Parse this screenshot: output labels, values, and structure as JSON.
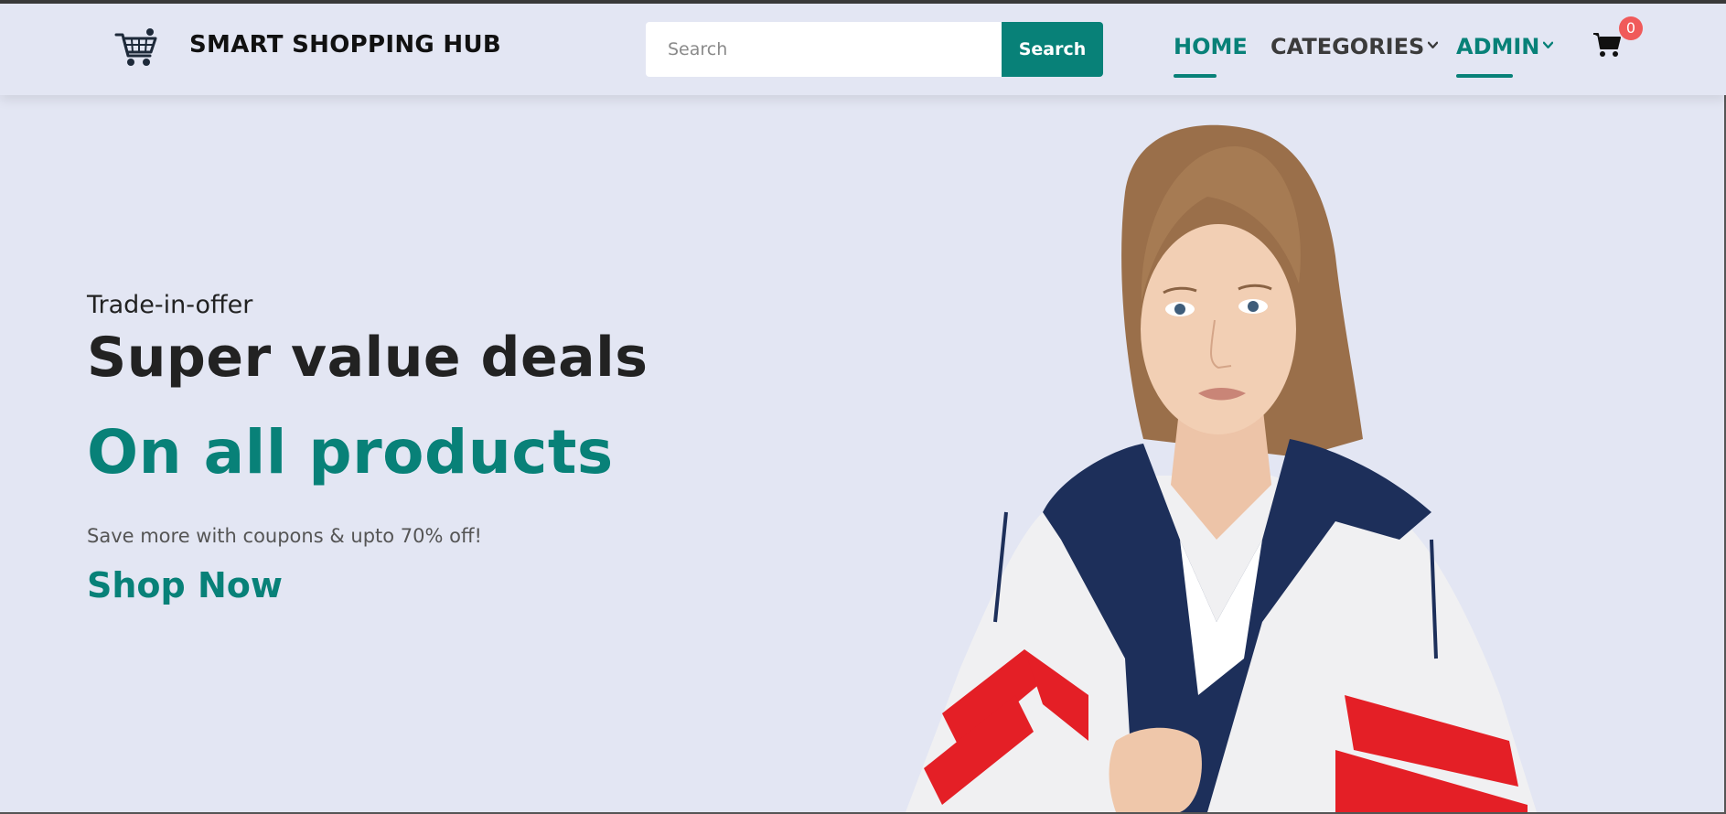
{
  "brand": {
    "name": "SMART SHOPPING HUB",
    "logo_icon": "shopping-cart-logo-icon"
  },
  "search": {
    "placeholder": "Search",
    "value": "",
    "button_label": "Search"
  },
  "nav": {
    "items": [
      {
        "label": "HOME",
        "active": true,
        "has_dropdown": false
      },
      {
        "label": "CATEGORIES",
        "active": false,
        "has_dropdown": true
      },
      {
        "label": "ADMIN",
        "active": true,
        "has_dropdown": true
      }
    ],
    "cart": {
      "icon": "cart-icon",
      "count": "0"
    }
  },
  "hero": {
    "eyebrow": "Trade-in-offer",
    "headline_1": "Super value deals",
    "headline_2": "On all products",
    "subtext": "Save more with coupons & upto 70% off!",
    "cta_label": "Shop Now",
    "image": "fashion-model-jacket-image"
  },
  "colors": {
    "accent": "#088178",
    "background": "#e3e6f3",
    "badge": "#f05a5a",
    "text_dark": "#222222"
  }
}
